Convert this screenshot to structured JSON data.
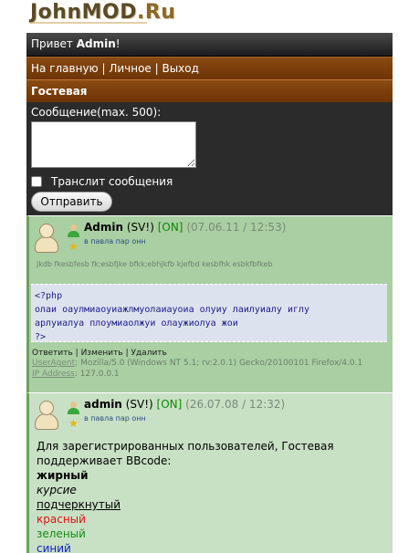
{
  "site": {
    "logo_main": "JohnMOD",
    "logo_suffix": ".Ru"
  },
  "greeting": {
    "prefix": "Привет ",
    "user": "Admin",
    "suffix": "!"
  },
  "nav": {
    "home": "На главную",
    "personal": "Личное",
    "logout": "Выход",
    "separator": " | "
  },
  "section_title": "Гостевая",
  "form": {
    "message_label": "Сообщение(max. 500):",
    "message_value": "",
    "translit_label": "Транслит сообщения",
    "submit_label": "Отправить"
  },
  "posts": [
    {
      "author": "Admin",
      "status_sv": "(SV!)",
      "online": "[ON]",
      "date": "(07.06.11 / 12:53)",
      "mail_link": "в павла пар онн",
      "text": "jkdb fkesbfesb fk;esbfjke bfkk;ebhjkfb kjefbd kesbfhk esbkfbfkeb",
      "code_lines": [
        "<?php",
        "олаи оаулмиаоуиажлмуолаиауоиа олуиу лаилуиалу иглу",
        "арлуиалуа плоумиаолжуи олаужиолуа жои",
        "?>"
      ],
      "actions": {
        "reply": "Ответить",
        "edit": "Изменить",
        "delete": "Удалить",
        "separator": " | "
      },
      "useragent_label": "UserAgent",
      "useragent": "Mozilla/5.0 (Windows NT 5.1; rv:2.0.1) Gecko/20100101 Firefox/4.0.1",
      "ip_label": "IP Address",
      "ip": "127.0.0.1"
    },
    {
      "author": "admin",
      "status_sv": "(SV!)",
      "online": "[ON]",
      "date": "(26.07.08 / 12:32)",
      "mail_link": "в павла пар онн",
      "intro_line1": "Для зарегистрированных пользователей, Гостевая",
      "intro_line2": "поддерживает BBcode:",
      "bold": "жирный",
      "italic": "курсие",
      "underline": "подчеркнутый",
      "red": "красный",
      "green": "зеленый",
      "blue": "синий"
    }
  ],
  "colors": {
    "dark_bar": "#2b2b2b",
    "brown_bar": "#7a3e0c",
    "post_bg": "#a9cfa2",
    "online": "#0a8a0a"
  },
  "icons": [
    "user-avatar-icon",
    "user-online-icon",
    "star-icon"
  ]
}
